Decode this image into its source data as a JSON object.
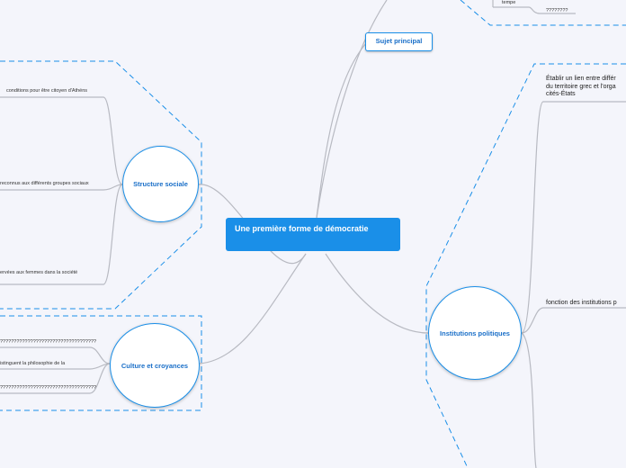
{
  "central": {
    "label": "Une première forme de démocratie"
  },
  "topics": {
    "subject": "Sujet principal",
    "structure": "Structure sociale",
    "culture": "Culture et croyances",
    "institutions": "Institutions politiques"
  },
  "structure_leaves": [
    "conditions pour être citoyen d'Athéns",
    "reconnus aux différents groupes sociaux",
    "ervées aux femmes dans la société"
  ],
  "culture_leaves": [
    "???????????????????????????????????",
    "istinguent la philosophie de la",
    "???????????????????????????????????"
  ],
  "top_leaves": [
    "tempe",
    "????????"
  ],
  "institutions_leaves": {
    "first_lines": [
      "Établir un lien entre différ",
      "du territoire grec et l'orga",
      "cités-États"
    ],
    "second": "fonction des institutions p"
  },
  "colors": {
    "accent": "#1a8fe8",
    "branch": "#bfc1c8",
    "background": "#f4f5fb"
  }
}
